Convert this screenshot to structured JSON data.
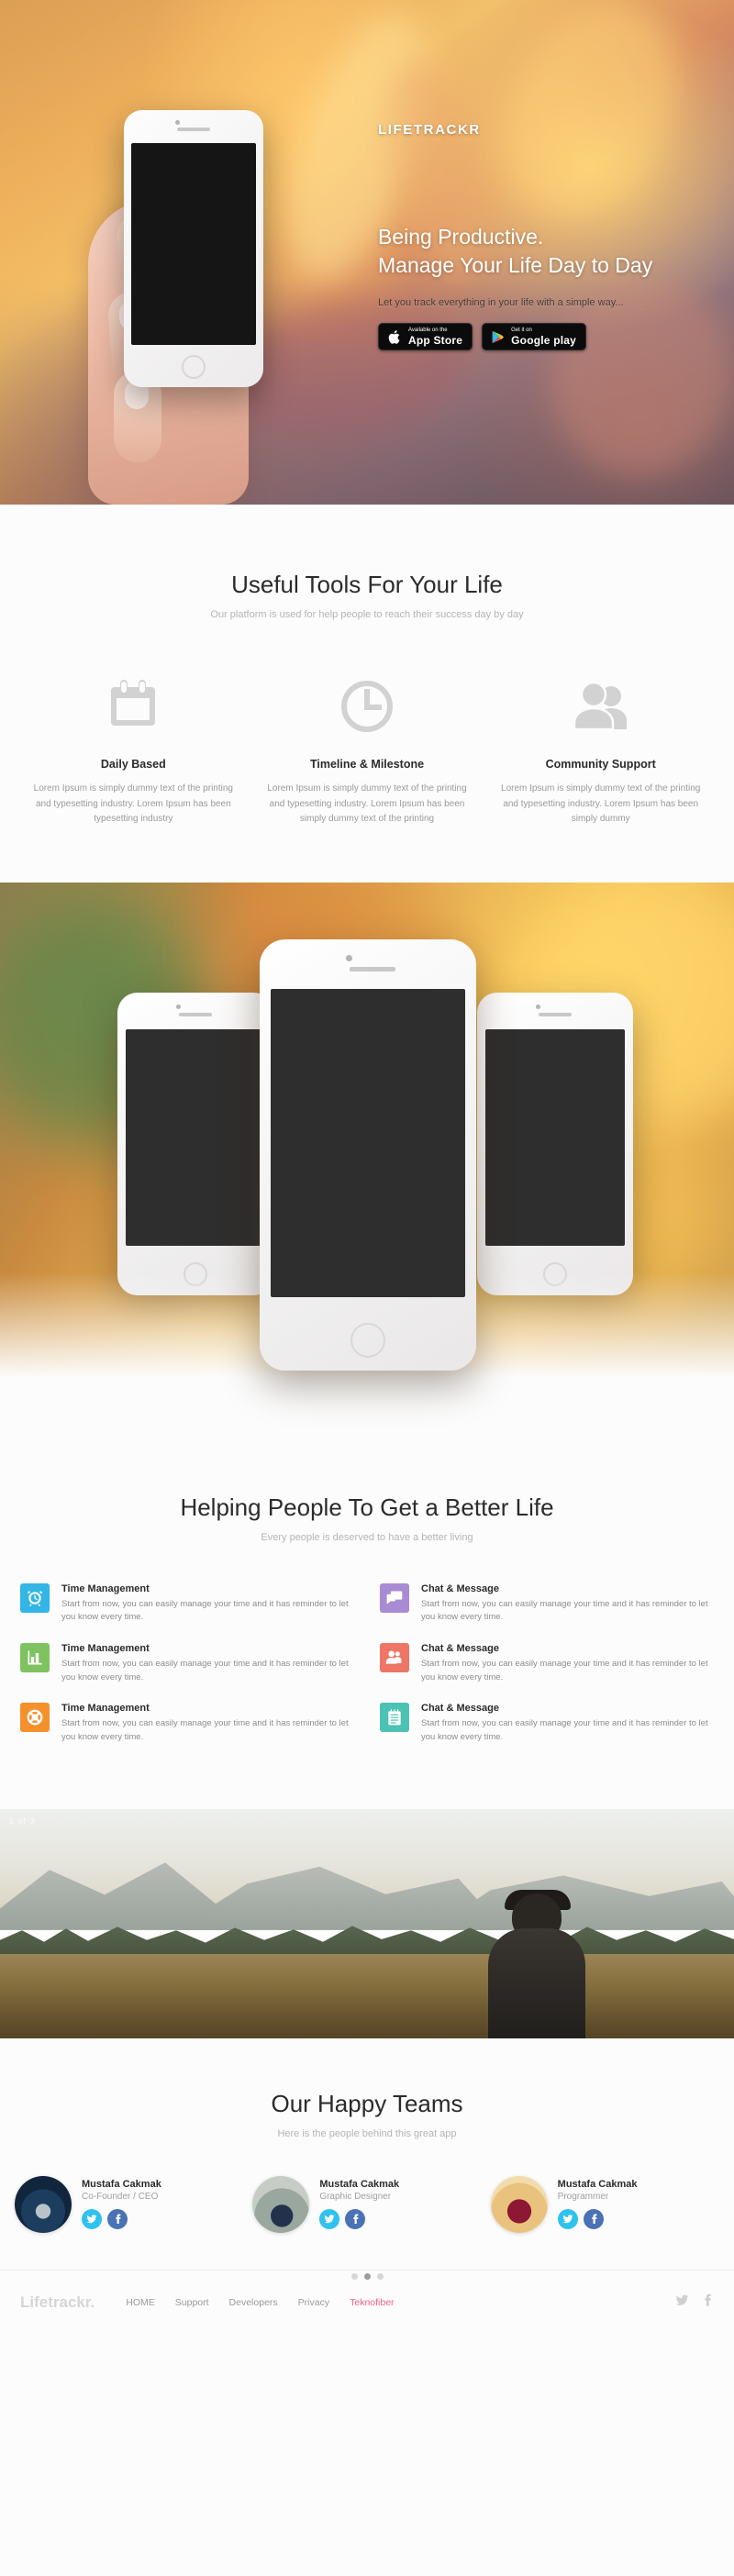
{
  "hero": {
    "logo": "LIFETRACKR",
    "title_line1": "Being Productive.",
    "title_line2": "Manage Your Life Day to Day",
    "subtitle": "Let you track everything in your life with a simple way...",
    "appstore_small": "Available on the",
    "appstore_big": "App Store",
    "googleplay_small": "Get it on",
    "googleplay_big": "Google play"
  },
  "tools": {
    "title": "Useful Tools For Your Life",
    "subtitle": "Our platform is used for help people to reach their success day by day",
    "items": [
      {
        "icon": "calendar-icon",
        "title": "Daily Based",
        "text": "Lorem Ipsum is simply dummy text of the printing and typesetting industry. Lorem Ipsum has been typesetting industry"
      },
      {
        "icon": "clock-icon",
        "title": "Timeline & Milestone",
        "text": "Lorem Ipsum is simply dummy text of the printing and typesetting industry. Lorem Ipsum has been simply dummy text of the printing"
      },
      {
        "icon": "users-icon",
        "title": "Community Support",
        "text": "Lorem Ipsum is simply dummy text of the printing and typesetting industry. Lorem Ipsum has been simply dummy"
      }
    ]
  },
  "helping": {
    "title": "Helping People To Get a Better Life",
    "subtitle": "Every people is deserved to have a better living",
    "features": [
      {
        "icon": "alarm-clock-icon",
        "color": "#33b5e5",
        "title": "Time Management",
        "text": "Start from now, you can easily manage your time and it has reminder to let you know every time."
      },
      {
        "icon": "chat-bubbles-icon",
        "color": "#a98bd4",
        "title": "Chat & Message",
        "text": "Start from now, you can easily manage your time and it has reminder to let you know every time."
      },
      {
        "icon": "bar-chart-icon",
        "color": "#7fc261",
        "title": "Time Management",
        "text": "Start from now, you can easily manage your time and it has reminder to let you know every time."
      },
      {
        "icon": "users-icon",
        "color": "#ef7566",
        "title": "Chat & Message",
        "text": "Start from now, you can easily manage your time and it has reminder to let you know every time."
      },
      {
        "icon": "lifebuoy-icon",
        "color": "#f5912d",
        "title": "Time Management",
        "text": "Start from now, you can easily manage your time and it has reminder to let you know every time."
      },
      {
        "icon": "notepad-icon",
        "color": "#4cc2b4",
        "title": "Chat & Message",
        "text": "Start from now, you can easily manage your time and it has reminder to let you know every time."
      }
    ]
  },
  "slider": {
    "counter": "2 of 3",
    "active_dot": 1,
    "dot_count": 3
  },
  "team": {
    "title": "Our Happy Teams",
    "subtitle": "Here is the people behind this great app",
    "members": [
      {
        "name": "Mustafa Cakmak",
        "role": "Co-Founder / CEO"
      },
      {
        "name": "Mustafa Cakmak",
        "role": "Graphic Designer"
      },
      {
        "name": "Mustafa Cakmak",
        "role": "Programmer"
      }
    ]
  },
  "footer": {
    "logo": "Lifetrackr.",
    "nav": [
      {
        "label": "HOME",
        "accent": false
      },
      {
        "label": "Support",
        "accent": false
      },
      {
        "label": "Developers",
        "accent": false
      },
      {
        "label": "Privacy",
        "accent": false
      },
      {
        "label": "Teknofiber",
        "accent": true
      }
    ],
    "accent_color": "#f1618c"
  }
}
